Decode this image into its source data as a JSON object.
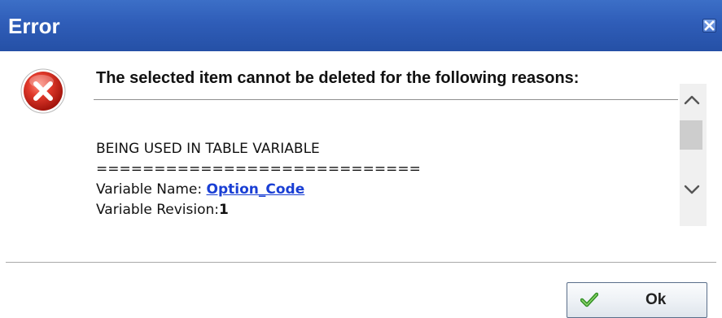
{
  "dialog": {
    "title": "Error",
    "headline": "The selected item cannot be deleted for the following reasons:",
    "details": {
      "reason": "BEING USED IN TABLE VARIABLE",
      "separator": "============================",
      "variable_name_label": "Variable Name: ",
      "variable_name_value": "Option_Code",
      "variable_revision_label": "Variable Revision:",
      "variable_revision_value": "1"
    },
    "ok_label": "Ok"
  },
  "icons": {
    "close": "close-icon",
    "error": "error-icon",
    "scroll_up": "chevron-up-icon",
    "scroll_down": "chevron-down-icon",
    "ok": "check-icon"
  },
  "colors": {
    "titlebar": "#2f5db8",
    "error_red": "#d42a1e",
    "link": "#1a3fd4",
    "check_green": "#3a9a2a"
  }
}
